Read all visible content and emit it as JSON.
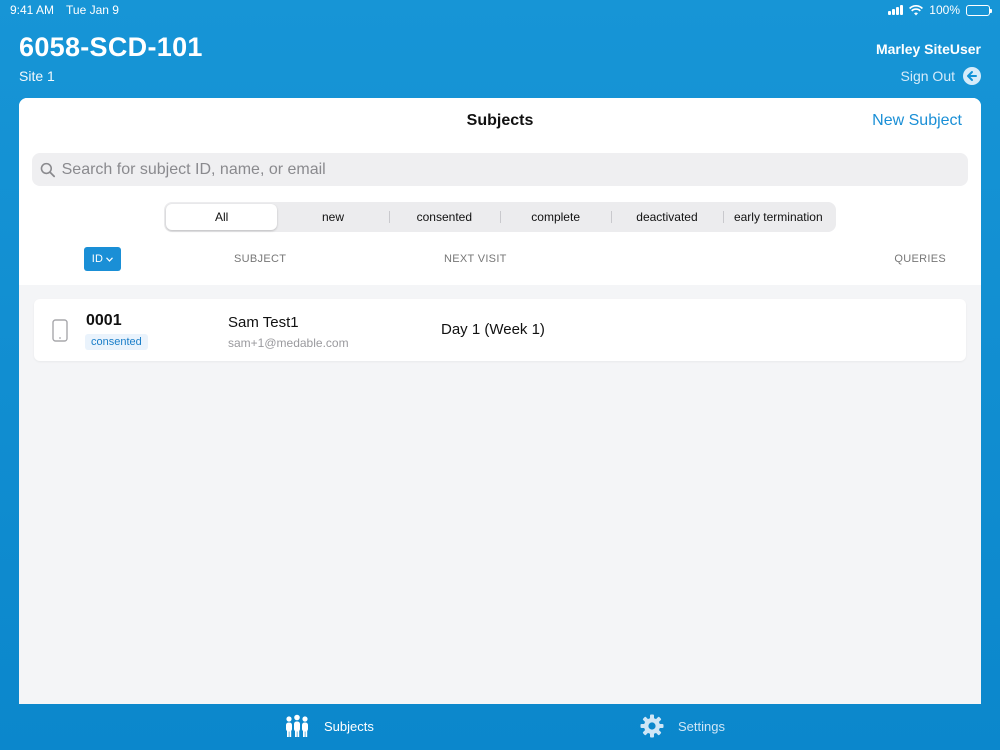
{
  "status": {
    "time": "9:41 AM",
    "date": "Tue Jan 9",
    "battery": "100%"
  },
  "header": {
    "study": "6058-SCD-101",
    "site": "Site 1",
    "user": "Marley SiteUser",
    "sign_out": "Sign Out"
  },
  "panel": {
    "title": "Subjects",
    "new_subject": "New Subject",
    "search_placeholder": "Search for subject ID, name, or email",
    "filters": [
      "All",
      "new",
      "consented",
      "complete",
      "deactivated",
      "early termination"
    ],
    "active_filter": "All",
    "sort_label": "ID",
    "columns": {
      "subject": "SUBJECT",
      "next_visit": "NEXT VISIT",
      "queries": "QUERIES"
    },
    "rows": [
      {
        "id": "0001",
        "status": "consented",
        "name": "Sam Test1",
        "email": "sam+1@medable.com",
        "next_visit": "Day 1 (Week 1)"
      }
    ]
  },
  "tabbar": {
    "subjects": "Subjects",
    "settings": "Settings"
  },
  "colors": {
    "brand_blue": "#1795d6",
    "accent": "#1a8fd6"
  },
  "icons": [
    "wifi-icon",
    "signal-icon",
    "battery-icon",
    "sign-out-icon",
    "search-icon",
    "chevron-down-icon",
    "phone-device-icon",
    "people-icon",
    "gear-icon"
  ]
}
